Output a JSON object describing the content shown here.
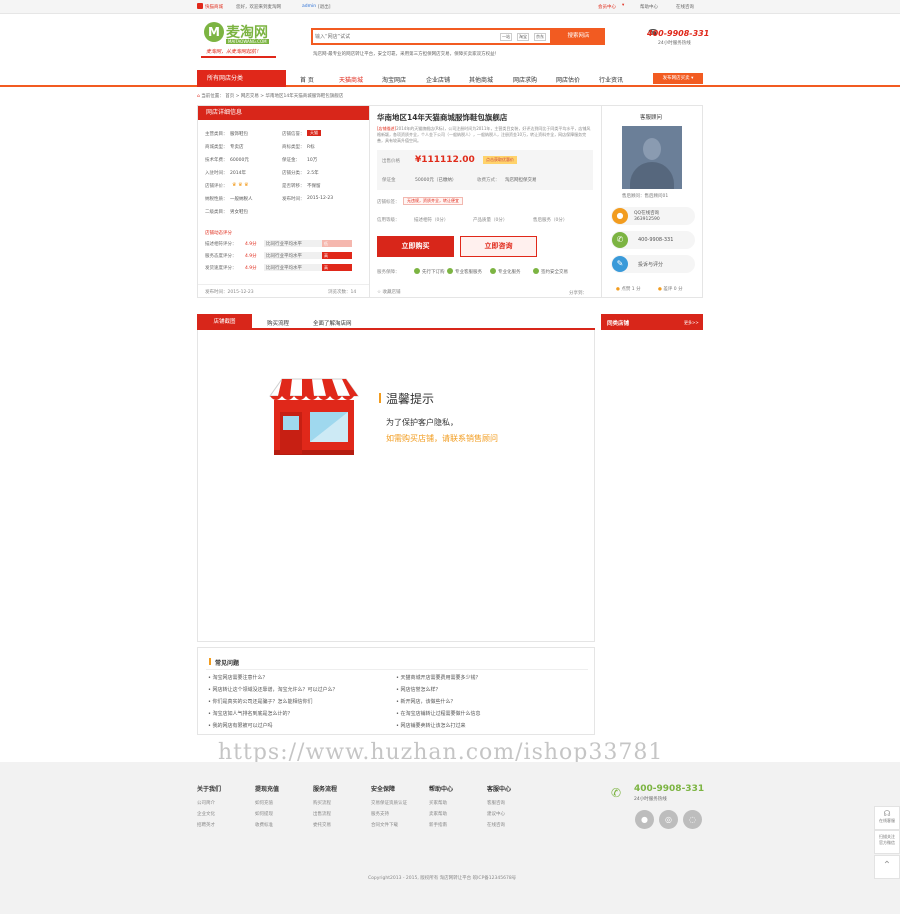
{
  "topbar": {
    "logo_link": "快猫商城",
    "greeting": "您好，欢迎来到麦淘网",
    "login": "admin",
    "logout": "[退出]",
    "member_center": "会员中心",
    "help_center": "帮助中心",
    "online_service": "在线咨询"
  },
  "header": {
    "logo_text": "麦淘网",
    "logo_url": "MAITAOWANG.COM",
    "slogan": "麦淘网，从麦淘网起航！",
    "search_placeholder": "输入“网店”试试",
    "search_tabs": [
      "一站",
      "淘宝",
      "京东"
    ],
    "search_button": "搜索网店",
    "tagline": "淘店网-最专业的网店转让平台，安全可靠，采用第三方担保网店交易，保障买卖家双方权益！",
    "hotline": "400-9908-331",
    "hotline_sub": "24小时服务热线"
  },
  "nav": {
    "category": "所有网店分类",
    "items": [
      "首 页",
      "天猫商城",
      "淘宝网店",
      "企业店铺",
      "其他商城",
      "网店求购",
      "网店估价",
      "行业资讯"
    ],
    "active_index": 1,
    "publish": "发布网店买卖"
  },
  "breadcrumb": {
    "prefix": "当前位置：",
    "home": "首页",
    "level2": "网店交易",
    "current": "华南地区14年天猫商城服饰鞋包旗舰店"
  },
  "shop_info": {
    "header": "网店详细信息",
    "rows": [
      {
        "k": "主营类目：",
        "v": "服饰鞋包"
      },
      {
        "k": "店铺信誉：",
        "v": "天猫"
      },
      {
        "k": "商城类型：",
        "v": "专卖店"
      },
      {
        "k": "商标类型：",
        "v": "R标"
      },
      {
        "k": "技术年费：",
        "v": "60000元"
      },
      {
        "k": "保证金：",
        "v": "10万"
      },
      {
        "k": "入驻时间：",
        "v": "2014年"
      },
      {
        "k": "店铺分类：",
        "v": "2.5年"
      },
      {
        "k": "店铺评价：",
        "v": ""
      },
      {
        "k": "是否转移：",
        "v": "不保留"
      },
      {
        "k": "纳税性质：",
        "v": "一般纳税人"
      },
      {
        "k": "发布时间：",
        "v": "2015-12-23"
      },
      {
        "k": "二级类目：",
        "v": "男女鞋包"
      }
    ],
    "dsr_header": "店铺动态评分",
    "dsr": [
      {
        "k": "描述相符评分：",
        "score": "4.9分",
        "cmp": "比同行业平均水平",
        "tag": "低"
      },
      {
        "k": "服务态度评分：",
        "score": "4.9分",
        "cmp": "比同行业平均水平",
        "tag": "高"
      },
      {
        "k": "发货速度评分：",
        "score": "4.9分",
        "cmp": "比同行业平均水平",
        "tag": "高"
      }
    ],
    "publish_time_label": "发布时间：2015-12-23",
    "browse_label": "浏览次数：14"
  },
  "listing": {
    "title": "华南地区14年天猫商城服饰鞋包旗舰店",
    "desc_tag": "[店铺描述]",
    "desc": "2014年的天猫旗舰店(R标)，公司注册时间为2011年，主营类目女装，好评达到同比于同类平均水平，店铺风格新颖，各项资质齐全，个人金下公司（一般纳税人），一般纳税人，注册资金10万，转让资料齐全，网店保障服务完善，具有较高升值空间。",
    "price_label": "出售价格",
    "price": "¥111112.00",
    "price_badge": "点击获取优惠价",
    "deposit_label": "保证金",
    "deposit": "50000元（已缴纳）",
    "pay_label": "收费方式：",
    "pay": "淘店网担保交易",
    "tags_label": "店铺标签：",
    "tags": "无违规，资质齐全，转让便宜",
    "check_label": "信用等级：",
    "checks": [
      "描述相符（0分）",
      "产品质量（0分）",
      "售后服务（0分）"
    ],
    "buy_btn": "立即购买",
    "consult_btn": "立即咨询",
    "guarantee_label": "服务保障：",
    "guarantees": [
      "先行下订购",
      "专业客服服务",
      "专业化服务",
      "签约安全交易"
    ],
    "fav": "收藏店铺",
    "share": "分享到："
  },
  "advisor": {
    "header": "客服顾问",
    "name": "售后顾问：售后顾问01",
    "qq_label": "QQ在线咨询",
    "qq": "363912590",
    "phone": "400-9908-331",
    "complain": "投诉与评分",
    "like": "点赞 1 分",
    "dislike": "差评 0 分"
  },
  "tabs": {
    "items": [
      "店铺截图",
      "购买流程",
      "全面了解淘店网"
    ],
    "active": 0
  },
  "notice": {
    "title": "温馨提示",
    "line1": "为了保护客户隐私，",
    "line2": "如需购买店铺，请联系销售顾问"
  },
  "similar": {
    "header": "同类店铺",
    "more": "更多>>"
  },
  "faq": {
    "header": "常见问题",
    "left": [
      "• 淘宝网店需要注意什么？",
      "• 网店转让这个领域没还靠谱，淘宝允许么？可以过户么？",
      "• 你们是真实的公司还是骗子？怎么能相信你们",
      "• 淘宝店如人气排名到底是怎么计的？",
      "• 我的网店有限被可以过户吗"
    ],
    "right": [
      "• 天猫商城开店需要费用需要多少钱？",
      "• 网店信誉怎么样？",
      "• 新开网店，该做些什么？",
      "• 在淘宝店铺转让过程需要做什么信息",
      "• 网店铺要卖转让该怎么打过来"
    ]
  },
  "watermark": "https://www.huzhan.com/ishop33781",
  "footer": {
    "cols": [
      {
        "title": "关于我们",
        "links": [
          "公司简介",
          "企业文化",
          "招聘英才"
        ]
      },
      {
        "title": "提现充值",
        "links": [
          "如何充值",
          "如何提现",
          "收费标准"
        ]
      },
      {
        "title": "服务流程",
        "links": [
          "购买流程",
          "出售流程",
          "委托交易"
        ]
      },
      {
        "title": "安全保障",
        "links": [
          "交易保证资质认证",
          "服务支持",
          "合同文件下载"
        ]
      },
      {
        "title": "帮助中心",
        "links": [
          "买家帮助",
          "卖家帮助",
          "新手指南"
        ]
      },
      {
        "title": "客服中心",
        "links": [
          "客服咨询",
          "建议中心",
          "在线咨询"
        ]
      }
    ],
    "hotline": "400-9908-331",
    "hotline_sub": "24小时服务热线",
    "copyright": "Copyright2013 - 2015, 版权所有 淘店网转让平台 皖ICP备12345678号"
  },
  "side": {
    "service": "在线客服",
    "qr": "扫描关注",
    "qr2": "官方微信",
    "top": "顶部"
  },
  "colors": {
    "accent": "#e0281a",
    "orange": "#f25b21",
    "green": "#7cb442"
  }
}
